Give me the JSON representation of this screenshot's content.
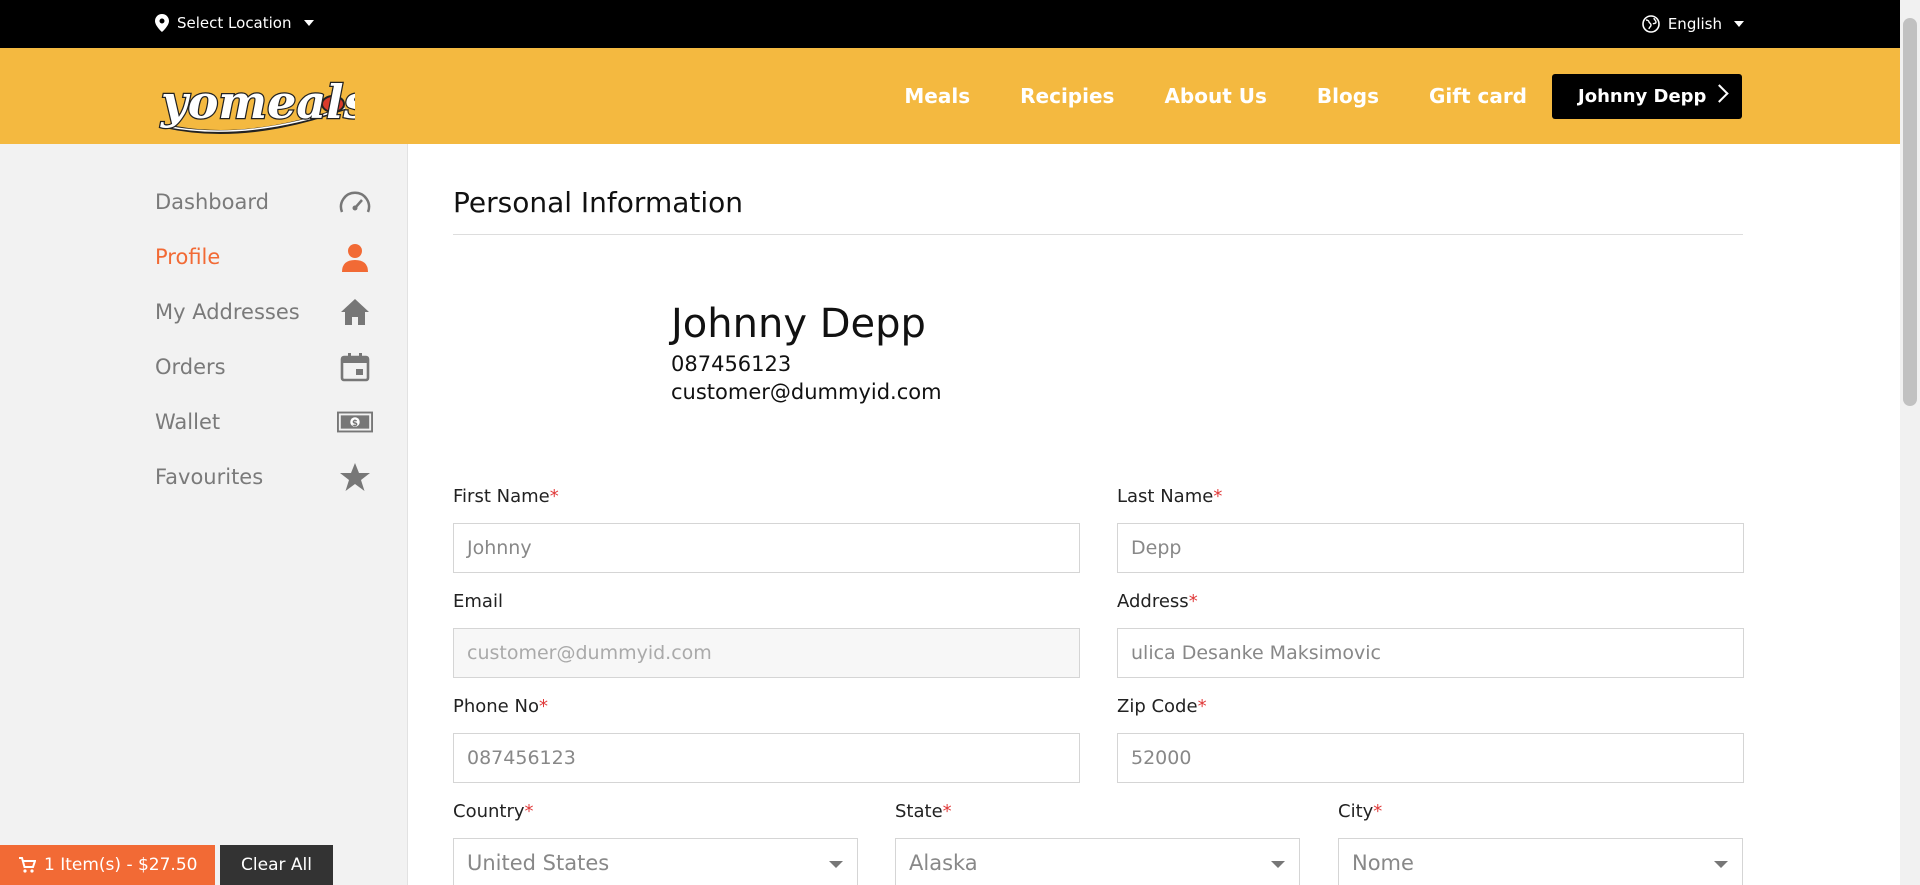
{
  "topbar": {
    "location_label": "Select Location",
    "language_label": "English"
  },
  "header": {
    "logo_text": "yomeals",
    "nav": [
      "Meals",
      "Recipies",
      "About Us",
      "Blogs",
      "Gift card"
    ],
    "user_button": "Johnny Depp",
    "brand_color": "#f4b940"
  },
  "sidebar": {
    "items": [
      {
        "label": "Dashboard",
        "icon": "speedometer-icon"
      },
      {
        "label": "Profile",
        "icon": "person-icon",
        "active": true
      },
      {
        "label": "My Addresses",
        "icon": "home-icon"
      },
      {
        "label": "Orders",
        "icon": "calendar-icon"
      },
      {
        "label": "Wallet",
        "icon": "money-icon"
      },
      {
        "label": "Favourites",
        "icon": "star-icon"
      }
    ],
    "active_color": "#f26a35"
  },
  "main": {
    "title": "Personal Information",
    "profile": {
      "name": "Johnny Depp",
      "phone": "087456123",
      "email": "customer@dummyid.com"
    },
    "form": {
      "first_name": {
        "label": "First Name",
        "value": "Johnny"
      },
      "last_name": {
        "label": "Last Name",
        "value": "Depp"
      },
      "email": {
        "label": "Email",
        "value": "customer@dummyid.com"
      },
      "address": {
        "label": "Address",
        "value": "ulica Desanke Maksimovic"
      },
      "phone": {
        "label": "Phone No",
        "value": "087456123"
      },
      "zip": {
        "label": "Zip Code",
        "value": "52000"
      },
      "country": {
        "label": "Country",
        "value": "United States"
      },
      "state": {
        "label": "State",
        "value": "Alaska"
      },
      "city": {
        "label": "City",
        "value": "Nome"
      },
      "required_mark": "*"
    }
  },
  "cart": {
    "summary": "1 Item(s) - $27.50",
    "clear_label": "Clear All"
  }
}
